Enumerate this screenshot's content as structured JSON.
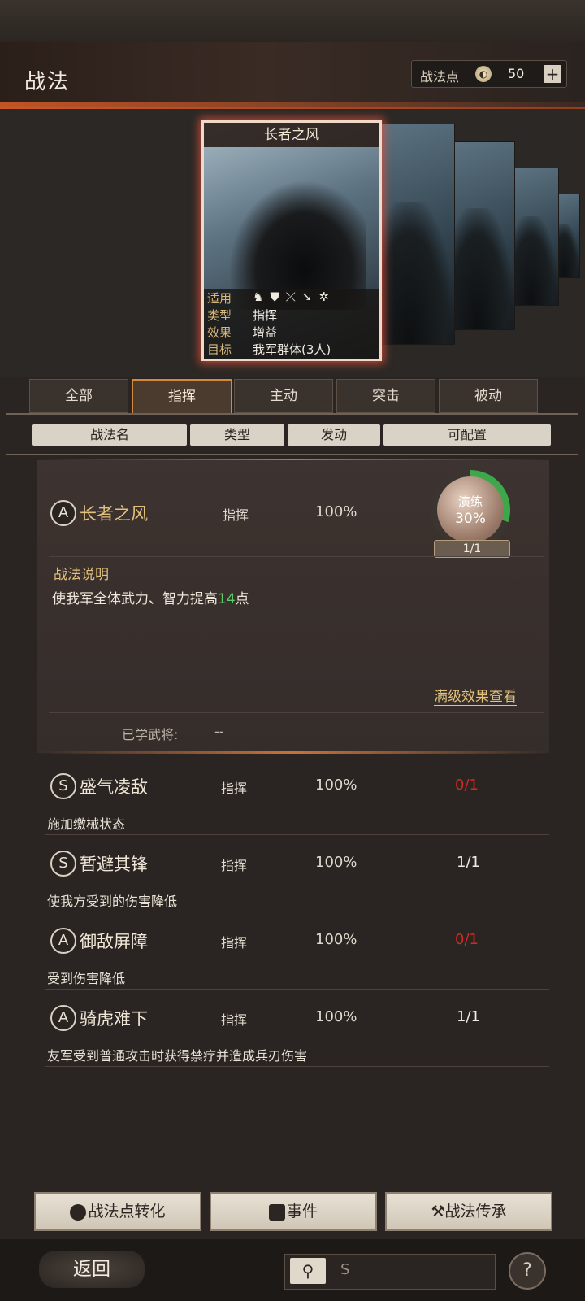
{
  "header": {
    "title": "战法",
    "points_label": "战法点",
    "points_value": "50",
    "points_add": "+"
  },
  "card": {
    "title": "长者之风",
    "rows": [
      {
        "key": "适用",
        "value": ""
      },
      {
        "key": "类型",
        "value": "指挥"
      },
      {
        "key": "效果",
        "value": "增益"
      },
      {
        "key": "目标",
        "value": "我军群体(3人)"
      }
    ],
    "applicable_icons": [
      "cavalry-icon",
      "shield-icon",
      "bow-icon",
      "spear-icon",
      "siege-icon"
    ]
  },
  "tabs": [
    "全部",
    "指挥",
    "主动",
    "突击",
    "被动"
  ],
  "active_tab": "指挥",
  "columns": [
    "战法名",
    "类型",
    "发动",
    "可配置"
  ],
  "selected": {
    "grade": "A",
    "name": "长者之风",
    "type": "指挥",
    "rate": "100%",
    "train_label": "演练",
    "train_pct": "30%",
    "train_progress": 0.3,
    "count": "1/1",
    "desc_title": "战法说明",
    "desc_before": "使我军全体武力、智力提高",
    "desc_num": "14",
    "desc_after": "点",
    "full_level": "满级效果查看",
    "learned_label": "已学武将:",
    "learned_value": "--"
  },
  "skills": [
    {
      "grade": "S",
      "name": "盛气凌敌",
      "type": "指挥",
      "rate": "100%",
      "config": "0/1",
      "config_color": "#d22a1e",
      "desc": "施加缴械状态"
    },
    {
      "grade": "S",
      "name": "暂避其锋",
      "type": "指挥",
      "rate": "100%",
      "config": "1/1",
      "config_color": "#f0ebe2",
      "desc": "使我方受到的伤害降低"
    },
    {
      "grade": "A",
      "name": "御敌屏障",
      "type": "指挥",
      "rate": "100%",
      "config": "0/1",
      "config_color": "#d22a1e",
      "desc": "受到伤害降低"
    },
    {
      "grade": "A",
      "name": "骑虎难下",
      "type": "指挥",
      "rate": "100%",
      "config": "1/1",
      "config_color": "#f0ebe2",
      "desc": "友军受到普通攻击时获得禁疗并造成兵刃伤害"
    }
  ],
  "footer": {
    "convert": "战法点转化",
    "event": "事件",
    "inherit": "战法传承"
  },
  "bottom": {
    "back": "返回",
    "search_value": "S",
    "help": "?"
  }
}
